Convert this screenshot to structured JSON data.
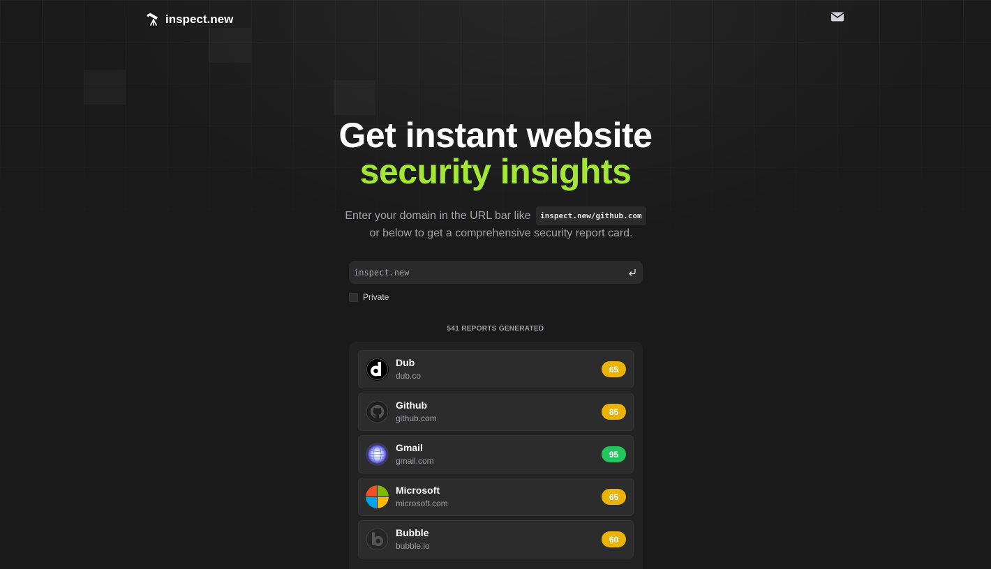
{
  "header": {
    "brand": "inspect.new",
    "brand_icon": "telescope-icon",
    "mail_icon": "mail-icon"
  },
  "hero": {
    "line1": "Get instant website",
    "line2": "security insights"
  },
  "subtitle": {
    "before": "Enter your domain in the URL bar like",
    "code": "inspect.new/github.com",
    "after": "or below to get a comprehensive security report card."
  },
  "search": {
    "placeholder": "inspect.new",
    "enter_icon": "enter-icon"
  },
  "private": {
    "label": "Private"
  },
  "reports": {
    "count_label": "541 REPORTS GENERATED",
    "items": [
      {
        "name": "Dub",
        "domain": "dub.co",
        "score": "65",
        "score_color": "#eab308",
        "icon": "dub-logo-icon"
      },
      {
        "name": "Github",
        "domain": "github.com",
        "score": "85",
        "score_color": "#eab308",
        "icon": "github-logo-icon"
      },
      {
        "name": "Gmail",
        "domain": "gmail.com",
        "score": "95",
        "score_color": "#22c55e",
        "icon": "gmail-globe-icon"
      },
      {
        "name": "Microsoft",
        "domain": "microsoft.com",
        "score": "65",
        "score_color": "#eab308",
        "icon": "microsoft-logo-icon"
      },
      {
        "name": "Bubble",
        "domain": "bubble.io",
        "score": "60",
        "score_color": "#eab308",
        "icon": "bubble-logo-icon"
      }
    ]
  },
  "colors": {
    "accent": "#a3e635",
    "background": "#1a1a1a",
    "score_yellow": "#eab308",
    "score_green": "#22c55e"
  }
}
